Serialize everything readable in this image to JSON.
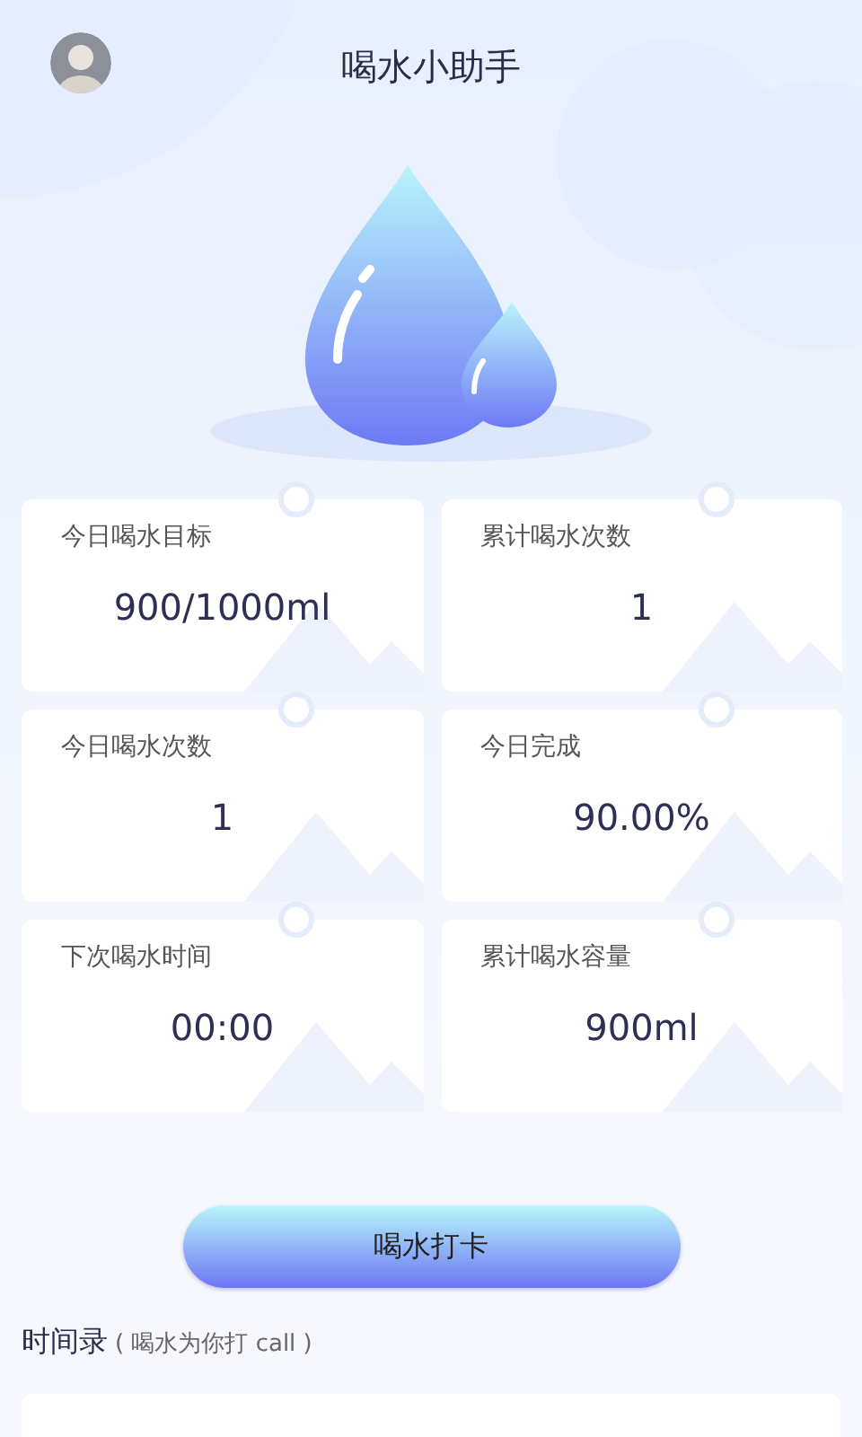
{
  "header": {
    "title": "喝水小助手"
  },
  "stats": [
    {
      "label": "今日喝水目标",
      "value": "900/1000ml"
    },
    {
      "label": "累计喝水次数",
      "value": "1"
    },
    {
      "label": "今日喝水次数",
      "value": "1"
    },
    {
      "label": "今日完成",
      "value": "90.00%"
    },
    {
      "label": "下次喝水时间",
      "value": "00:00"
    },
    {
      "label": "累计喝水容量",
      "value": "900ml"
    }
  ],
  "checkin_button": {
    "label": "喝水打卡"
  },
  "records": {
    "title": "时间录",
    "subtitle": "( 喝水为你打 call )"
  }
}
